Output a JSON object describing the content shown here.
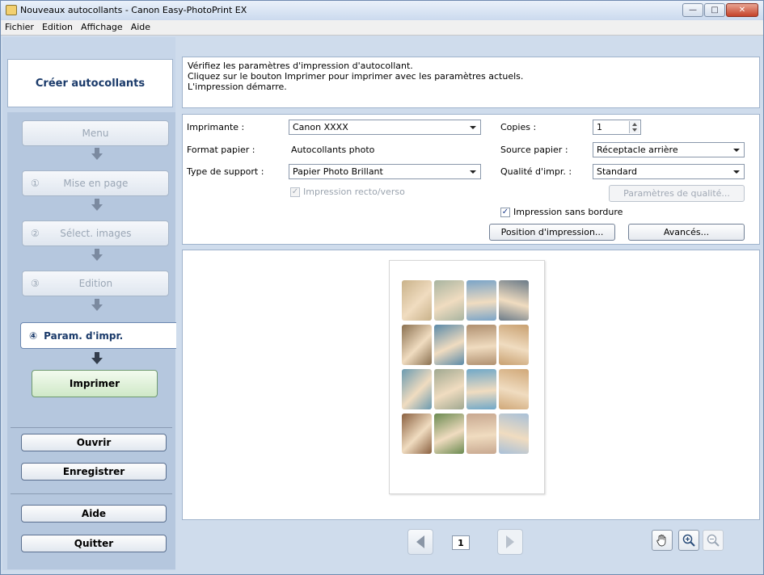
{
  "window": {
    "title": "Nouveaux autocollants - Canon Easy-PhotoPrint EX"
  },
  "menubar": {
    "items": [
      "Fichier",
      "Edition",
      "Affichage",
      "Aide"
    ]
  },
  "sidebar": {
    "header": "Créer autocollants",
    "menu_label": "Menu",
    "steps": [
      {
        "num": "①",
        "label": "Mise en page"
      },
      {
        "num": "②",
        "label": "Sélect. images"
      },
      {
        "num": "③",
        "label": "Edition"
      },
      {
        "num": "④",
        "label": "Param. d'impr."
      }
    ],
    "print_label": "Imprimer",
    "open_label": "Ouvrir",
    "save_label": "Enregistrer",
    "help_label": "Aide",
    "quit_label": "Quitter"
  },
  "info": {
    "line1": "Vérifiez les paramètres d'impression d'autocollant.",
    "line2": "Cliquez sur le bouton Imprimer pour imprimer avec les paramètres actuels.",
    "line3": "L'impression démarre."
  },
  "settings": {
    "printer_label": "Imprimante :",
    "printer_value": "Canon XXXX",
    "paper_format_label": "Format papier :",
    "paper_format_value": "Autocollants photo",
    "media_type_label": "Type de support :",
    "media_type_value": "Papier Photo Brillant",
    "duplex_label": "Impression recto/verso",
    "duplex_checked": true,
    "copies_label": "Copies :",
    "copies_value": "1",
    "paper_source_label": "Source papier :",
    "paper_source_value": "Réceptacle arrière",
    "quality_label": "Qualité d'impr. :",
    "quality_value": "Standard",
    "quality_settings_label": "Paramètres de qualité...",
    "borderless_label": "Impression sans bordure",
    "borderless_checked": true,
    "print_position_label": "Position d'impression...",
    "advanced_label": "Avancés..."
  },
  "preview": {
    "page_number": "1",
    "photo_colors": [
      [
        "#c9b28a",
        "#a8b4a0",
        "#7aa4c8",
        "#6a7a88"
      ],
      [
        "#8a7050",
        "#5a8aa8",
        "#b09070",
        "#c8a070"
      ],
      [
        "#6a9ab0",
        "#a0a890",
        "#70a8c8",
        "#d0a878"
      ],
      [
        "#8a6040",
        "#6a8a50",
        "#c8a890",
        "#a8c0d8"
      ]
    ]
  }
}
